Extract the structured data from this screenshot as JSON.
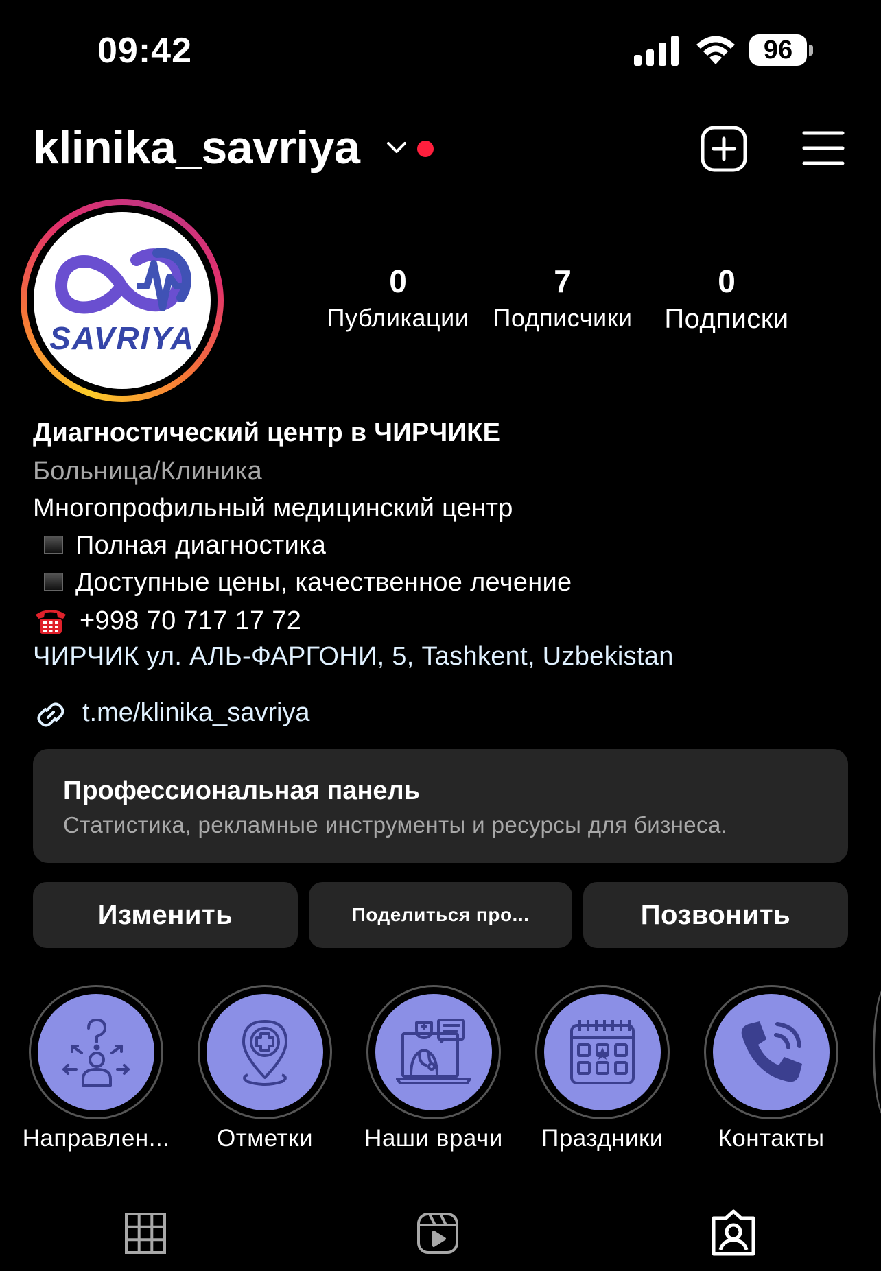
{
  "status_bar": {
    "time": "09:42",
    "battery": "96"
  },
  "header": {
    "username": "klinika_savriya"
  },
  "avatar": {
    "logo_text": "SAVRIYA"
  },
  "stats": [
    {
      "value": "0",
      "label": "Публикации"
    },
    {
      "value": "7",
      "label": "Подписчики"
    },
    {
      "value": "0",
      "label": "Подписки"
    }
  ],
  "bio": {
    "name": "Диагностический центр в ЧИРЧИКЕ",
    "category": "Больница/Клиника",
    "lines": [
      "Многопрофильный медицинский центр",
      "Полная диагностика",
      "Доступные цены, качественное лечение",
      "+998 70 717 17 72"
    ],
    "address": "ЧИРЧИК ул. АЛЬ-ФАРГОНИ, 5, Tashkent, Uzbekistan",
    "link": "t.me/klinika_savriya"
  },
  "pro_panel": {
    "title": "Профессиональная панель",
    "subtitle": "Статистика, рекламные инструменты и ресурсы для бизнеса."
  },
  "actions": {
    "edit": "Изменить",
    "share": "Поделиться про...",
    "call": "Позвонить"
  },
  "highlights": [
    {
      "label": "Направлен...",
      "icon": "directions-icon"
    },
    {
      "label": "Отметки",
      "icon": "medical-pin-icon"
    },
    {
      "label": "Наши врачи",
      "icon": "doctor-icon"
    },
    {
      "label": "Праздники",
      "icon": "calendar-icon"
    },
    {
      "label": "Контакты",
      "icon": "phone-icon"
    }
  ],
  "colors": {
    "background": "#000000",
    "card": "#262626",
    "highlight_fill": "#8b8fe6",
    "link": "#e0f1ff",
    "notification_dot": "#ff1f3d"
  }
}
